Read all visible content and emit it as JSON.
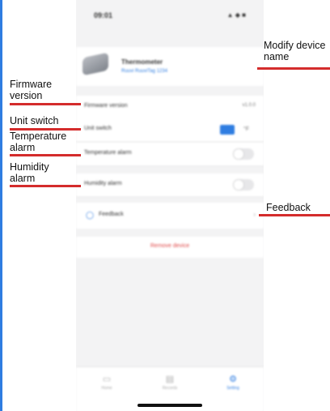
{
  "phone": {
    "status_time": "09:01",
    "status_icons": "▲ ◆ ■",
    "device_name": "Thermometer",
    "device_sub": "Ruuvi RuuviTag 1234",
    "rows": [
      {
        "label": "Firmware version",
        "value": "v1.0.0"
      },
      {
        "label": "Unit switch"
      },
      {
        "label": "Temperature alarm"
      },
      {
        "label": "Humidity alarm"
      }
    ],
    "unit_on": "°C",
    "unit_off": "°F",
    "feedback_label": "Feedback",
    "delete_label": "Remove device",
    "tabs": [
      {
        "label": "Home",
        "icon": "home-icon"
      },
      {
        "label": "Records",
        "icon": "records-icon"
      },
      {
        "label": "Setting",
        "icon": "settings-icon"
      }
    ]
  },
  "annotations": {
    "modify_device_name": "Modify device name",
    "firmware_version": "Firmware version",
    "unit_switch": "Unit switch",
    "temperature_alarm": "Temperature alarm",
    "humidity_alarm": "Humidity alarm",
    "feedback": "Feedback"
  },
  "colors": {
    "accent": "#2f7de1",
    "annotation_line": "#d42c2c",
    "left_bar": "#2f7de1"
  }
}
